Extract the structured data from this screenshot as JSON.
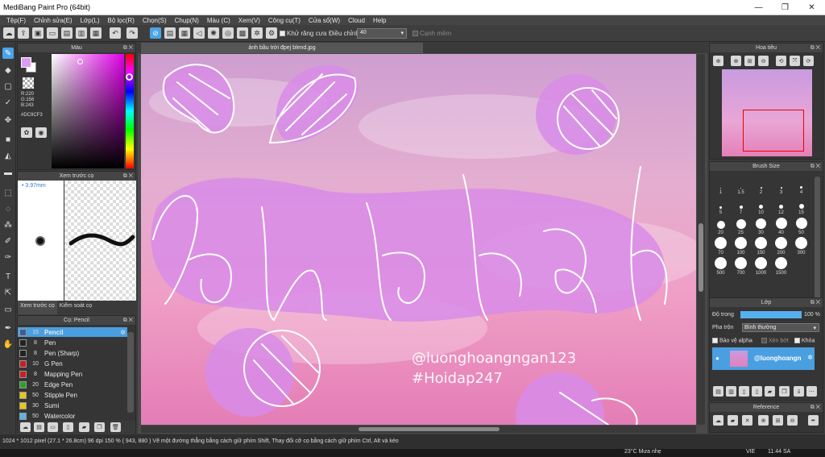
{
  "window": {
    "title": "MediBang Paint Pro (64bit)"
  },
  "menu": [
    "Tệp(F)",
    "Chỉnh sửa(E)",
    "Lớp(L)",
    "Bộ lọc(R)",
    "Chọn(S)",
    "Chụp(N)",
    "Màu (C)",
    "Xem(V)",
    "Công cụ(T)",
    "Cửa sổ(W)",
    "Cloud",
    "Help"
  ],
  "toolbar": {
    "antialias_label": "Khử răng cưa",
    "correction_label": "Điều chỉnh",
    "correction_value": "40",
    "snap_label": "Cạnh mềm"
  },
  "color_panel": {
    "title": "Màu",
    "r": "R:220",
    "g": "G:156",
    "b": "B:243",
    "hex": "#DC9CF3",
    "fg": "#dc9cf3"
  },
  "brush_preview": {
    "title": "Xem trước cọ",
    "size": "3.97mm",
    "tab_preview": "Xem trước cọ",
    "tab_control": "Kiểm soát cọ"
  },
  "brush_list": {
    "title": "Cọ: Pencil",
    "items": [
      {
        "size": "15",
        "name": "Pencil",
        "color": "#3a5f9a"
      },
      {
        "size": "8",
        "name": "Pen",
        "color": "#222222"
      },
      {
        "size": "8",
        "name": "Pen (Sharp)",
        "color": "#222222"
      },
      {
        "size": "10",
        "name": "G Pen",
        "color": "#c91f1f"
      },
      {
        "size": "8",
        "name": "Mapping Pen",
        "color": "#c91f1f"
      },
      {
        "size": "20",
        "name": "Edge Pen",
        "color": "#2ca02c"
      },
      {
        "size": "50",
        "name": "Stipple Pen",
        "color": "#e6c619"
      },
      {
        "size": "30",
        "name": "Sumi",
        "color": "#e6c619"
      },
      {
        "size": "50",
        "name": "Watercolor",
        "color": "#5ab4e6"
      }
    ]
  },
  "document": {
    "tab": "ảnh bầu trời đpej blend.jpg",
    "watermark_line1": "@luonghoangngan123",
    "watermark_line2": "#Hoidap247"
  },
  "navigator": {
    "title": "Hoa tiêu"
  },
  "brush_size": {
    "title": "Brush Size",
    "sizes": [
      "1",
      "1.5",
      "2",
      "3",
      "4",
      "5",
      "7",
      "10",
      "12",
      "15",
      "20",
      "25",
      "30",
      "40",
      "50",
      "70",
      "100",
      "150",
      "200",
      "300",
      "500",
      "700",
      "1000",
      "1500"
    ]
  },
  "layers": {
    "title": "Lớp",
    "opacity_label": "Độ trong",
    "opacity_value": "100 %",
    "opacity": 1.0,
    "blend_label": "Pha trộn",
    "blend_value": "Bình thường",
    "protect_alpha": "Bảo vệ alpha",
    "clipping": "Xén bớt",
    "lock": "Khóa",
    "layer_name": "@luonghoangn"
  },
  "reference": {
    "title": "Reference"
  },
  "status": {
    "text": "1024 * 1012 pixel   (27.1 * 26.8cm)  96 dpi   150 %   ( 943, 880 )   Vẽ một đường thẳng bằng cách giữ phím Shift, Thay đổi cỡ cọ bằng cách giữ phím Ctrl, Alt và kéo"
  },
  "taskbar": {
    "weather": "23°C  Mưa nhẹ",
    "lang": "VIE",
    "time": "11:44 SA"
  }
}
